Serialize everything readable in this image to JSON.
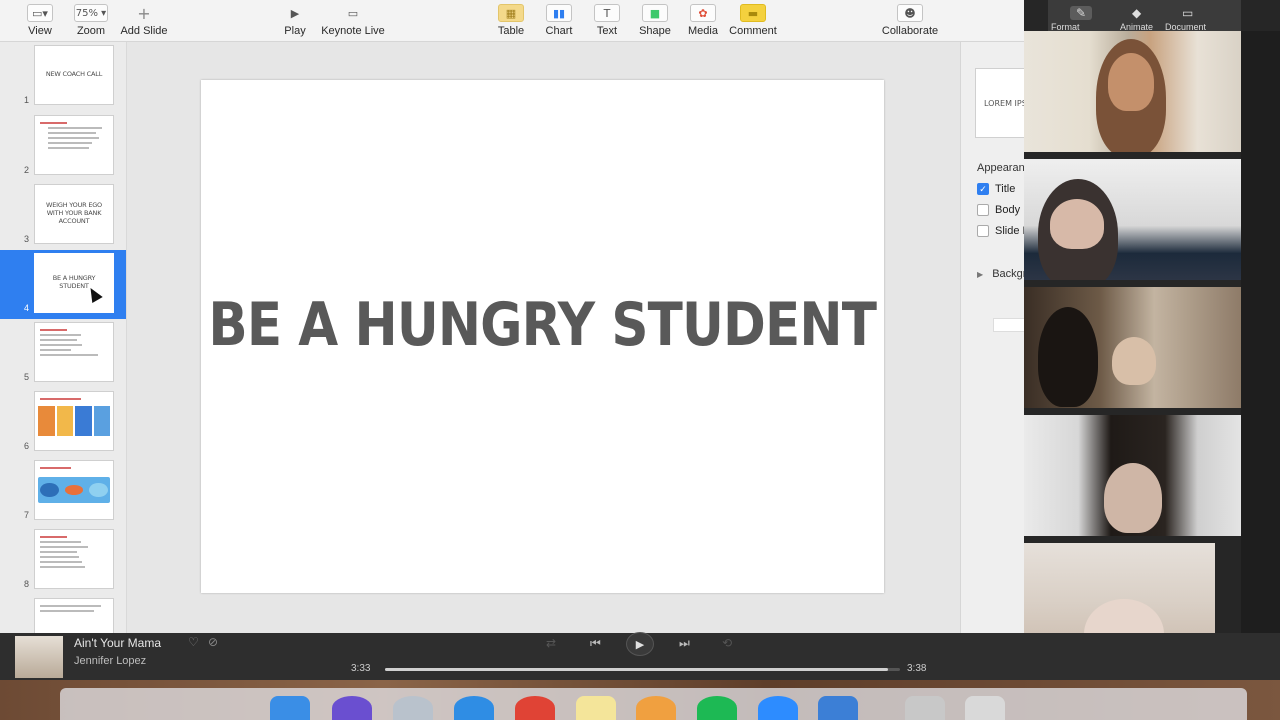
{
  "toolbar": {
    "zoom_value": "75%",
    "items": [
      {
        "label": "View",
        "icon": "▭▾"
      },
      {
        "label": "Zoom",
        "icon": "75% ▾"
      },
      {
        "label": "Add Slide",
        "icon": "+"
      },
      {
        "label": "Play",
        "icon": "▶"
      },
      {
        "label": "Keynote Live",
        "icon": "▭"
      },
      {
        "label": "Table",
        "icon": "▦"
      },
      {
        "label": "Chart",
        "icon": "▮▮"
      },
      {
        "label": "Text",
        "icon": "T"
      },
      {
        "label": "Shape",
        "icon": "■"
      },
      {
        "label": "Media",
        "icon": "✿"
      },
      {
        "label": "Comment",
        "icon": "▬"
      },
      {
        "label": "Collaborate",
        "icon": "☻"
      }
    ]
  },
  "navigator": {
    "selected_index": 4,
    "slides": [
      {
        "num": "1",
        "title": "NEW COACH CALL"
      },
      {
        "num": "2",
        "title": ""
      },
      {
        "num": "3",
        "title": "WEIGH YOUR EGO WITH YOUR BANK ACCOUNT"
      },
      {
        "num": "4",
        "title": "BE A HUNGRY STUDENT"
      },
      {
        "num": "5",
        "title": ""
      },
      {
        "num": "6",
        "title": ""
      },
      {
        "num": "7",
        "title": ""
      },
      {
        "num": "8",
        "title": ""
      }
    ]
  },
  "slide": {
    "title": "BE A HUNGRY STUDENT"
  },
  "inspector": {
    "preview_text": "LOREM IPSUM",
    "appearance_heading": "Appearan",
    "options": [
      {
        "label": "Title",
        "checked": true
      },
      {
        "label": "Body",
        "checked": false
      },
      {
        "label": "Slide N",
        "checked": false
      }
    ],
    "background_label": "Backgr"
  },
  "inspector_tabs": [
    {
      "label": "Format",
      "icon": "✎"
    },
    {
      "label": "Animate",
      "icon": "◆"
    },
    {
      "label": "Document",
      "icon": "▭"
    }
  ],
  "music": {
    "title": "Ain't Your Mama",
    "artist": "Jennifer Lopez",
    "elapsed": "3:33",
    "total": "3:38",
    "progress": 0.977
  },
  "colors": {
    "accent": "#2f7ff0",
    "slide_title": "#595959"
  }
}
